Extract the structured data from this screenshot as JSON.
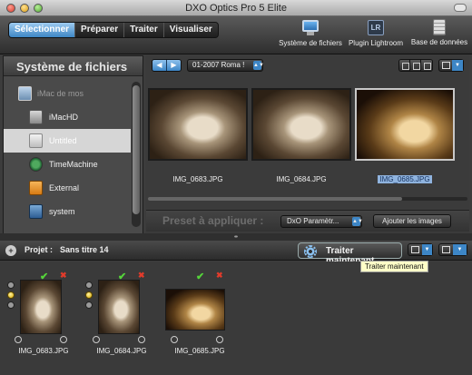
{
  "window": {
    "title": "DXO Optics Pro 5 Elite"
  },
  "tabs": [
    {
      "label": "Sélectionner",
      "active": true
    },
    {
      "label": "Préparer",
      "active": false
    },
    {
      "label": "Traiter",
      "active": false
    },
    {
      "label": "Visualiser",
      "active": false
    }
  ],
  "toolbar": {
    "filesystem_label": "Système de fichiers",
    "lightroom_label": "Plugin Lightroom",
    "lightroom_badge": "LR",
    "database_label": "Base de données"
  },
  "left_panel": {
    "title": "Système de fichiers",
    "items": [
      {
        "label": "iMac de mos",
        "icon": "imac-icon"
      },
      {
        "label": "iMacHD",
        "icon": "hard-drive-icon"
      },
      {
        "label": "Untitled",
        "icon": "hard-drive-icon",
        "selected": true
      },
      {
        "label": "TimeMachine",
        "icon": "time-machine-icon"
      },
      {
        "label": "External",
        "icon": "external-drive-icon"
      },
      {
        "label": "system",
        "icon": "system-drive-icon"
      }
    ]
  },
  "browser": {
    "folder": "01-2007 Roma !",
    "thumbnails": [
      {
        "filename": "IMG_0683.JPG"
      },
      {
        "filename": "IMG_0684.JPG"
      },
      {
        "filename": "IMG_0685.JPG",
        "selected": true
      }
    ],
    "preset_label": "Preset à appliquer :",
    "preset_value": "DxO Paramètr...",
    "add_images_label": "Ajouter les images"
  },
  "project": {
    "label": "Projet :",
    "name": "Sans titre 14",
    "process_button": "Traiter maintenant",
    "tooltip": "Traiter maintenant",
    "items": [
      {
        "filename": "IMG_0683.JPG"
      },
      {
        "filename": "IMG_0684.JPG"
      },
      {
        "filename": "IMG_0685.JPG"
      }
    ]
  },
  "colors": {
    "accent": "#3e87c5",
    "check": "#55d43a",
    "remove": "#e23b2b"
  }
}
